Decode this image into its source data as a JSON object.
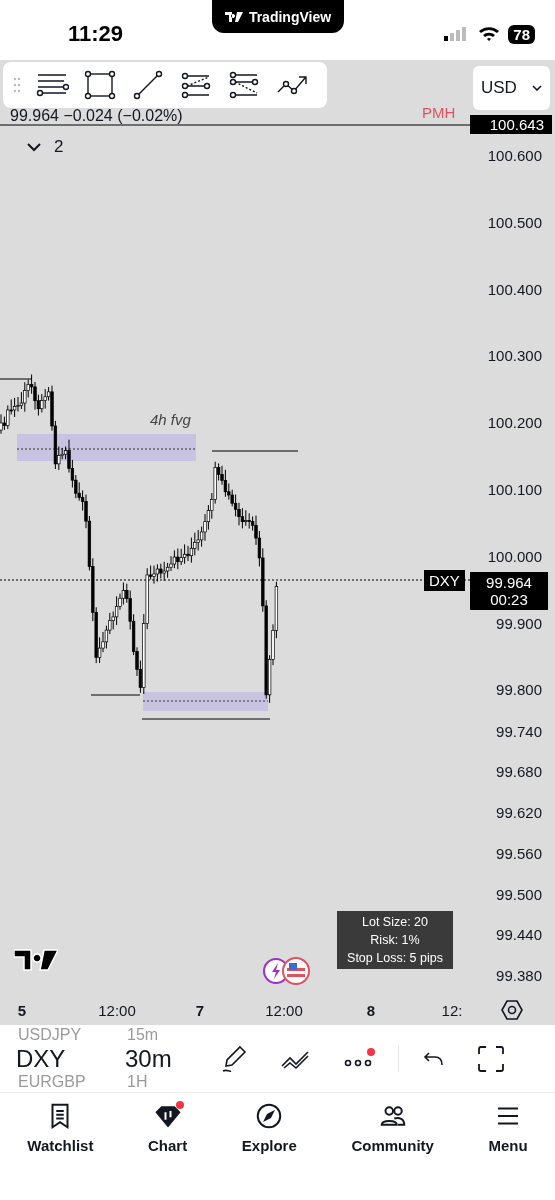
{
  "status_bar": {
    "time": "11:29",
    "app_pill": "TradingView",
    "battery": "78"
  },
  "currency_select": {
    "value": "USD"
  },
  "chart": {
    "quote": "99.964 −0.024 (−0.02%)",
    "collapse_count": "2",
    "pmh_label": "PMH",
    "pmh_price": "100.643",
    "fvg_label": "4h fvg",
    "symbol_tag": "DXY",
    "price_tag": {
      "price": "99.964",
      "countdown": "00:23"
    },
    "price_axis": [
      "100.600",
      "100.500",
      "100.400",
      "100.300",
      "100.200",
      "100.100",
      "100.000",
      "99.900",
      "99.800",
      "99.740",
      "99.680",
      "99.620",
      "99.560",
      "99.500",
      "99.440",
      "99.380"
    ],
    "position_info": [
      "Lot Size: 20",
      "Risk: 1%",
      "Stop Loss: 5 pips"
    ],
    "time_axis": [
      {
        "label": "5",
        "kind": "day"
      },
      {
        "label": "12:00",
        "kind": "time"
      },
      {
        "label": "7",
        "kind": "day"
      },
      {
        "label": "12:00",
        "kind": "time"
      },
      {
        "label": "8",
        "kind": "day"
      },
      {
        "label": "12:",
        "kind": "time"
      }
    ]
  },
  "symbol_bar": {
    "previous": {
      "symbol": "USDJPY",
      "interval": "15m"
    },
    "current": {
      "symbol": "DXY",
      "interval": "30m"
    },
    "next": {
      "symbol": "EURGBP",
      "interval": "1H"
    },
    "more_badge": true
  },
  "tabs": [
    {
      "label": "Watchlist",
      "selected": false,
      "badge": false
    },
    {
      "label": "Chart",
      "selected": true,
      "badge": true
    },
    {
      "label": "Explore",
      "selected": false,
      "badge": false
    },
    {
      "label": "Community",
      "selected": false,
      "badge": false
    },
    {
      "label": "Menu",
      "selected": false,
      "badge": false
    }
  ]
}
